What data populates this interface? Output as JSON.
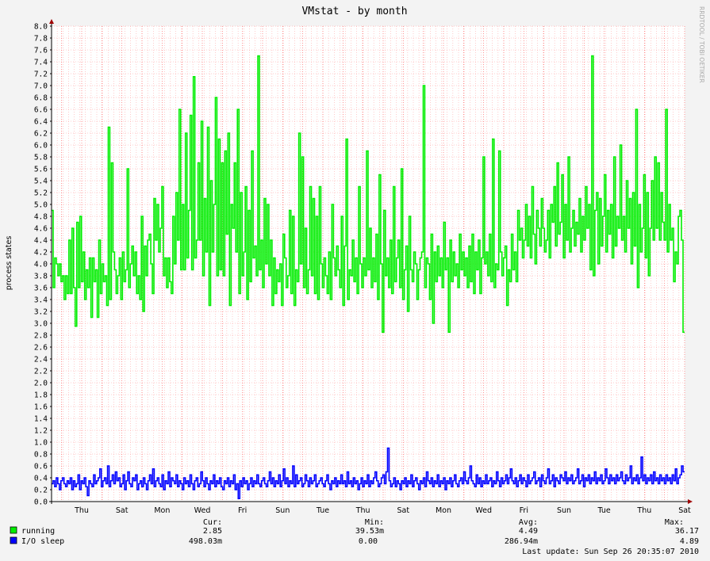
{
  "chart_data": {
    "type": "line",
    "title": "VMstat - by month",
    "ylabel": "process states",
    "watermark": "RRDTOOL / TOBI OETIKER",
    "ylim": [
      0,
      8.0
    ],
    "ytick_step": 0.2,
    "x_day_labels": [
      "Thu",
      "Sat",
      "Mon",
      "Wed",
      "Fri",
      "Sun",
      "Tue",
      "Thu",
      "Sat",
      "Mon",
      "Wed",
      "Fri",
      "Sun",
      "Tue",
      "Thu",
      "Sat"
    ],
    "grid": true,
    "colors": {
      "running": "#00ee00",
      "io_sleep": "#0000ff",
      "plot_bg": "#ffffff",
      "grid": "#ff9999",
      "page_bg": "#f3f3f3"
    },
    "series": [
      {
        "name": "running",
        "values": [
          4.9,
          3.6,
          4.1,
          4.0,
          3.8,
          4.0,
          3.7,
          3.8,
          3.4,
          3.8,
          3.5,
          4.4,
          3.5,
          4.6,
          3.6,
          2.95,
          4.7,
          3.6,
          4.8,
          3.7,
          4.2,
          3.4,
          3.9,
          3.6,
          4.1,
          3.1,
          4.1,
          3.7,
          3.9,
          3.1,
          4.4,
          3.5,
          4.0,
          3.7,
          3.8,
          3.3,
          6.3,
          3.4,
          5.7,
          4.2,
          3.9,
          3.5,
          3.8,
          4.1,
          3.4,
          4.2,
          3.7,
          3.9,
          5.6,
          3.6,
          4.0,
          4.3,
          3.8,
          4.2,
          3.5,
          3.8,
          3.4,
          4.8,
          3.2,
          4.3,
          3.8,
          4.4,
          4.5,
          4.0,
          3.5,
          5.1,
          4.4,
          5.0,
          4.2,
          4.6,
          5.3,
          3.8,
          4.1,
          3.6,
          4.1,
          3.7,
          3.5,
          4.8,
          4.0,
          5.2,
          4.4,
          6.6,
          3.9,
          5.0,
          3.9,
          6.2,
          4.1,
          4.9,
          6.5,
          3.9,
          7.15,
          4.1,
          4.4,
          5.7,
          4.4,
          6.4,
          3.8,
          5.1,
          4.2,
          6.3,
          3.3,
          5.4,
          4.2,
          5.0,
          6.8,
          3.8,
          6.1,
          3.9,
          5.7,
          3.8,
          5.9,
          4.5,
          6.2,
          3.3,
          5.0,
          4.6,
          5.7,
          4.2,
          6.6,
          3.5,
          5.2,
          3.8,
          4.2,
          5.3,
          3.4,
          4.9,
          3.7,
          5.9,
          4.1,
          4.3,
          3.8,
          7.5,
          3.9,
          4.4,
          3.6,
          5.1,
          4.0,
          5.0,
          3.8,
          4.4,
          3.3,
          4.1,
          3.5,
          3.9,
          3.7,
          4.0,
          3.3,
          4.5,
          4.1,
          3.6,
          3.8,
          4.9,
          3.5,
          4.8,
          3.3,
          3.9,
          3.7,
          6.2,
          4.0,
          5.8,
          3.6,
          4.6,
          3.5,
          3.9,
          5.3,
          3.8,
          5.1,
          3.5,
          4.8,
          3.4,
          5.3,
          4.0,
          3.6,
          4.1,
          3.8,
          3.5,
          4.2,
          3.4,
          5.0,
          4.1,
          3.8,
          4.3,
          3.9,
          3.6,
          4.8,
          3.3,
          4.3,
          6.1,
          3.4,
          3.9,
          3.8,
          4.4,
          3.7,
          4.1,
          3.5,
          5.3,
          4.0,
          3.6,
          4.1,
          3.8,
          5.9,
          3.9,
          4.6,
          3.6,
          4.1,
          3.7,
          4.5,
          3.4,
          5.5,
          4.0,
          2.85,
          4.9,
          3.8,
          4.1,
          3.6,
          4.4,
          3.5,
          5.3,
          3.7,
          4.1,
          4.4,
          3.6,
          5.6,
          3.4,
          3.9,
          4.3,
          3.2,
          4.8,
          3.9,
          3.7,
          4.2,
          4.0,
          3.4,
          3.9,
          4.1,
          4.2,
          7.0,
          3.6,
          4.1,
          4.0,
          3.4,
          4.5,
          3.0,
          4.2,
          3.7,
          4.3,
          3.8,
          4.1,
          3.6,
          4.7,
          3.9,
          4.1,
          2.85,
          4.4,
          3.7,
          4.2,
          3.8,
          4.0,
          3.6,
          4.5,
          3.9,
          4.2,
          3.8,
          4.1,
          3.6,
          4.3,
          3.7,
          4.5,
          3.5,
          4.2,
          3.9,
          4.4,
          3.5,
          4.1,
          5.8,
          4.0,
          4.2,
          3.8,
          4.5,
          3.7,
          6.1,
          3.6,
          4.0,
          3.9,
          5.9,
          4.2,
          3.8,
          4.1,
          4.3,
          3.3,
          3.9,
          3.7,
          4.5,
          3.9,
          4.2,
          3.7,
          4.9,
          4.4,
          4.6,
          4.1,
          4.4,
          5.0,
          4.3,
          4.8,
          4.1,
          5.3,
          4.5,
          4.0,
          4.9,
          4.6,
          4.3,
          5.1,
          4.6,
          4.2,
          4.4,
          4.9,
          4.1,
          5.0,
          4.7,
          5.3,
          4.3,
          5.7,
          4.5,
          4.7,
          5.5,
          4.1,
          5.0,
          4.4,
          5.8,
          4.2,
          4.6,
          4.9,
          4.3,
          4.7,
          4.5,
          5.1,
          4.2,
          4.8,
          4.4,
          5.3,
          4.6,
          5.0,
          3.9,
          7.5,
          3.8,
          4.9,
          5.2,
          4.0,
          5.1,
          4.3,
          4.8,
          5.5,
          4.2,
          4.9,
          4.5,
          5.0,
          4.1,
          5.8,
          4.3,
          4.8,
          4.6,
          6.0,
          4.4,
          4.8,
          4.2,
          5.4,
          4.6,
          5.1,
          4.0,
          5.2,
          4.3,
          6.6,
          3.6,
          5.0,
          4.2,
          4.6,
          5.5,
          4.1,
          5.2,
          3.8,
          4.6,
          5.4,
          4.4,
          5.8,
          4.6,
          5.7,
          4.4,
          5.2,
          4.7,
          4.4,
          6.6,
          4.2,
          5.0,
          4.4,
          4.6,
          3.7,
          4.2,
          4.0,
          4.8,
          4.9,
          4.4,
          2.85
        ]
      },
      {
        "name": "I/O sleep",
        "values": [
          0.3,
          0.35,
          0.25,
          0.4,
          0.3,
          0.2,
          0.35,
          0.4,
          0.3,
          0.25,
          0.35,
          0.3,
          0.4,
          0.2,
          0.35,
          0.25,
          0.3,
          0.45,
          0.2,
          0.35,
          0.3,
          0.4,
          0.25,
          0.1,
          0.35,
          0.3,
          0.25,
          0.45,
          0.3,
          0.35,
          0.4,
          0.55,
          0.25,
          0.35,
          0.4,
          0.3,
          0.6,
          0.25,
          0.35,
          0.45,
          0.3,
          0.5,
          0.35,
          0.4,
          0.25,
          0.3,
          0.45,
          0.2,
          0.35,
          0.5,
          0.3,
          0.25,
          0.4,
          0.35,
          0.45,
          0.2,
          0.3,
          0.35,
          0.25,
          0.4,
          0.3,
          0.2,
          0.35,
          0.45,
          0.3,
          0.55,
          0.25,
          0.35,
          0.4,
          0.3,
          0.25,
          0.45,
          0.2,
          0.35,
          0.3,
          0.5,
          0.25,
          0.4,
          0.35,
          0.3,
          0.45,
          0.25,
          0.35,
          0.3,
          0.2,
          0.4,
          0.3,
          0.35,
          0.25,
          0.45,
          0.3,
          0.2,
          0.35,
          0.4,
          0.25,
          0.3,
          0.5,
          0.35,
          0.25,
          0.4,
          0.3,
          0.2,
          0.35,
          0.3,
          0.45,
          0.25,
          0.35,
          0.3,
          0.4,
          0.25,
          0.2,
          0.35,
          0.3,
          0.4,
          0.25,
          0.35,
          0.3,
          0.45,
          0.2,
          0.3,
          0.05,
          0.35,
          0.25,
          0.4,
          0.3,
          0.35,
          0.2,
          0.3,
          0.4,
          0.25,
          0.35,
          0.3,
          0.45,
          0.3,
          0.25,
          0.35,
          0.4,
          0.3,
          0.25,
          0.35,
          0.5,
          0.3,
          0.4,
          0.25,
          0.35,
          0.3,
          0.45,
          0.25,
          0.35,
          0.55,
          0.3,
          0.4,
          0.25,
          0.35,
          0.3,
          0.6,
          0.25,
          0.45,
          0.3,
          0.35,
          0.4,
          0.25,
          0.3,
          0.45,
          0.35,
          0.25,
          0.4,
          0.3,
          0.35,
          0.45,
          0.25,
          0.3,
          0.35,
          0.4,
          0.3,
          0.25,
          0.35,
          0.45,
          0.3,
          0.2,
          0.35,
          0.3,
          0.4,
          0.25,
          0.35,
          0.3,
          0.45,
          0.3,
          0.35,
          0.25,
          0.5,
          0.3,
          0.35,
          0.25,
          0.4,
          0.3,
          0.35,
          0.2,
          0.3,
          0.4,
          0.25,
          0.35,
          0.3,
          0.45,
          0.25,
          0.35,
          0.3,
          0.4,
          0.5,
          0.35,
          0.25,
          0.3,
          0.4,
          0.45,
          0.3,
          0.5,
          0.9,
          0.35,
          0.25,
          0.3,
          0.4,
          0.25,
          0.35,
          0.3,
          0.2,
          0.35,
          0.3,
          0.4,
          0.25,
          0.35,
          0.3,
          0.45,
          0.25,
          0.35,
          0.4,
          0.3,
          0.2,
          0.35,
          0.3,
          0.4,
          0.25,
          0.5,
          0.35,
          0.3,
          0.4,
          0.25,
          0.35,
          0.3,
          0.45,
          0.25,
          0.35,
          0.3,
          0.4,
          0.2,
          0.35,
          0.3,
          0.4,
          0.25,
          0.35,
          0.45,
          0.3,
          0.25,
          0.35,
          0.4,
          0.3,
          0.5,
          0.35,
          0.3,
          0.4,
          0.6,
          0.35,
          0.3,
          0.25,
          0.45,
          0.3,
          0.4,
          0.25,
          0.35,
          0.3,
          0.45,
          0.3,
          0.35,
          0.4,
          0.25,
          0.35,
          0.3,
          0.5,
          0.35,
          0.25,
          0.4,
          0.3,
          0.35,
          0.45,
          0.3,
          0.4,
          0.55,
          0.35,
          0.3,
          0.4,
          0.25,
          0.35,
          0.45,
          0.3,
          0.4,
          0.35,
          0.25,
          0.45,
          0.3,
          0.35,
          0.4,
          0.5,
          0.3,
          0.35,
          0.4,
          0.25,
          0.45,
          0.35,
          0.3,
          0.4,
          0.55,
          0.3,
          0.35,
          0.45,
          0.25,
          0.4,
          0.35,
          0.3,
          0.45,
          0.4,
          0.35,
          0.5,
          0.3,
          0.4,
          0.35,
          0.45,
          0.3,
          0.35,
          0.4,
          0.55,
          0.3,
          0.35,
          0.45,
          0.25,
          0.4,
          0.35,
          0.45,
          0.3,
          0.4,
          0.35,
          0.5,
          0.3,
          0.4,
          0.35,
          0.45,
          0.3,
          0.35,
          0.55,
          0.4,
          0.3,
          0.45,
          0.35,
          0.4,
          0.3,
          0.45,
          0.35,
          0.4,
          0.5,
          0.35,
          0.3,
          0.45,
          0.35,
          0.4,
          0.6,
          0.3,
          0.4,
          0.35,
          0.45,
          0.3,
          0.4,
          0.75,
          0.35,
          0.45,
          0.3,
          0.4,
          0.35,
          0.45,
          0.3,
          0.5,
          0.35,
          0.4,
          0.3,
          0.45,
          0.35,
          0.4,
          0.3,
          0.45,
          0.35,
          0.4,
          0.3,
          0.45,
          0.35,
          0.55,
          0.3,
          0.4,
          0.45,
          0.6,
          0.5
        ]
      }
    ],
    "legend": {
      "headers": [
        "Cur:",
        "Min:",
        "Avg:",
        "Max:"
      ],
      "rows": [
        {
          "name": "running",
          "cur": "2.85",
          "min": "39.53m",
          "avg": "4.49",
          "max": "36.17"
        },
        {
          "name": "I/O sleep",
          "cur": "498.03m",
          "min": "0.00",
          "avg": "286.94m",
          "max": "4.89"
        }
      ]
    },
    "last_update": "Last update: Sun Sep 26 20:35:07 2010"
  }
}
